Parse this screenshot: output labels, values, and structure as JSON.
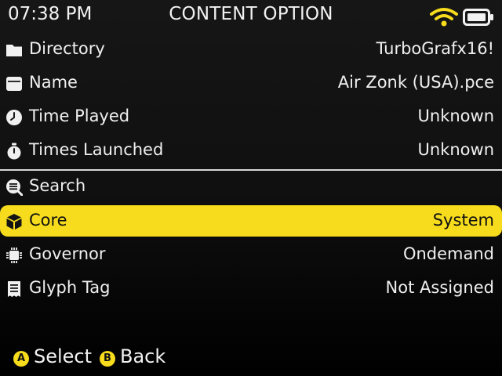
{
  "status": {
    "time": "07:38 PM",
    "title": "CONTENT OPTION",
    "wifi_icon": "wifi-icon",
    "battery_icon": "battery-icon",
    "accent": "#f6dc1c"
  },
  "info": [
    {
      "icon": "folder-icon",
      "label": "Directory",
      "value": "TurboGrafx16!"
    },
    {
      "icon": "card-icon",
      "label": "Name",
      "value": "Air Zonk (USA).pce"
    },
    {
      "icon": "clock-icon",
      "label": "Time Played",
      "value": "Unknown"
    },
    {
      "icon": "stopwatch-icon",
      "label": "Times Launched",
      "value": "Unknown"
    }
  ],
  "options": [
    {
      "icon": "search-list-icon",
      "label": "Search",
      "value": ""
    },
    {
      "icon": "cube-icon",
      "label": "Core",
      "value": "System",
      "selected": true
    },
    {
      "icon": "chip-icon",
      "label": "Governor",
      "value": "Ondemand"
    },
    {
      "icon": "receipt-icon",
      "label": "Glyph Tag",
      "value": "Not Assigned"
    }
  ],
  "footer": {
    "a_button": "A",
    "a_label": "Select",
    "b_button": "B",
    "b_label": "Back"
  }
}
